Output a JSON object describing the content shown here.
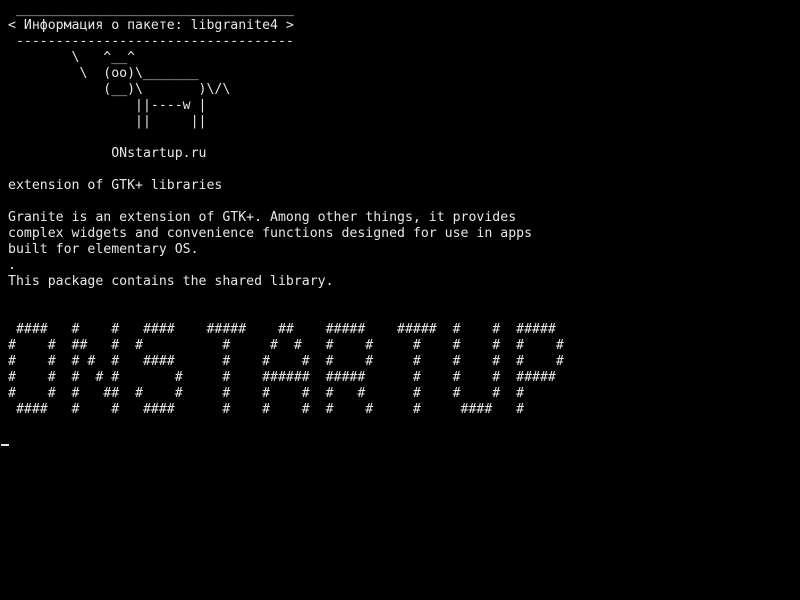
{
  "terminal": {
    "cowsay_box": {
      "top_border": " ___________________________________",
      "message": "< Информация о пакете: libgranite4 >",
      "bottom_border": " -----------------------------------"
    },
    "cow_art": [
      "        \\   ^__^",
      "         \\  (oo)\\_______",
      "            (__)\\       )\\/\\",
      "                ||----w |",
      "                ||     ||"
    ],
    "site_label": "             ONstartup.ru",
    "summary": "extension of GTK+ libraries",
    "description": [
      "Granite is an extension of GTK+. Among other things, it provides",
      "complex widgets and convenience functions designed for use in apps",
      "built for elementary OS.",
      ".",
      "This package contains the shared library."
    ],
    "banner_art": [
      " ####   #    #   ####    #####    ##    #####    #####  #    #  #####",
      "#    #  ##   #  #          #     #  #   #    #     #    #    #  #    #",
      "#    #  # #  #   ####      #    #    #  #    #     #    #    #  #    #",
      "#    #  #  # #       #     #    ######  #####      #    #    #  #####",
      "#    #  #   ##  #    #     #    #    #  #   #      #    #    #  #",
      " ####   #    #   ####      #    #    #  #    #     #     ####   #"
    ],
    "cursor_glyph": "_"
  }
}
